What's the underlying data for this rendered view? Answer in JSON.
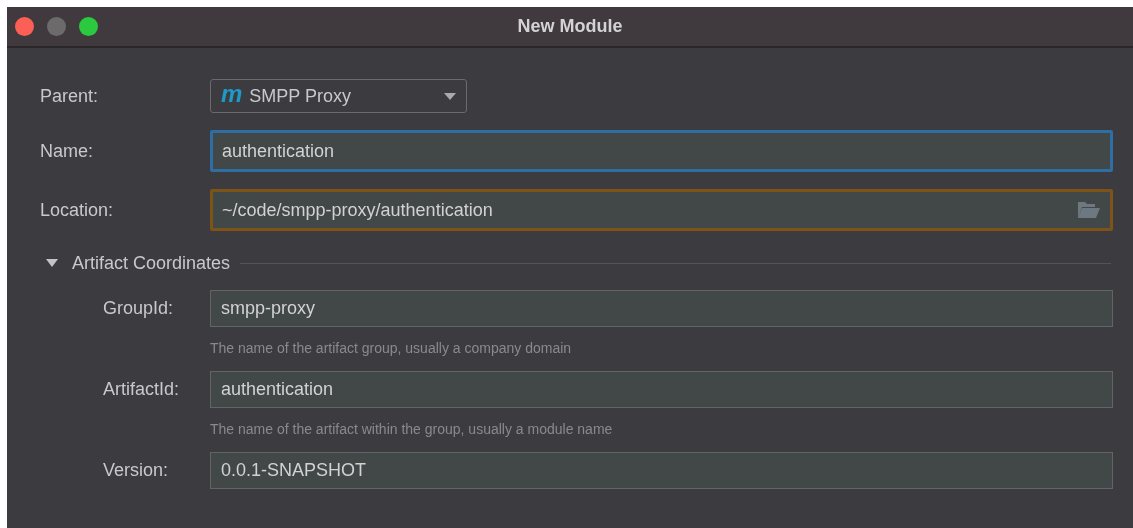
{
  "window": {
    "title": "New Module"
  },
  "parent": {
    "label": "Parent:",
    "value": "SMPP Proxy",
    "icon_letter": "m"
  },
  "fields": [
    {
      "label": "Name:",
      "value": "authentication",
      "focused": true,
      "warning": false
    },
    {
      "label": "Location:",
      "value": "~/code/smpp-proxy/authentication",
      "focused": false,
      "warning": true,
      "browse": true
    }
  ],
  "section": {
    "title": "Artifact Coordinates",
    "expanded": true,
    "fields": [
      {
        "label": "GroupId:",
        "value": "smpp-proxy",
        "hint": "The name of the artifact group, usually a company domain"
      },
      {
        "label": "ArtifactId:",
        "value": "authentication",
        "hint": "The name of the artifact within the group, usually a module name"
      },
      {
        "label": "Version:",
        "value": "0.0.1-SNAPSHOT"
      }
    ]
  }
}
